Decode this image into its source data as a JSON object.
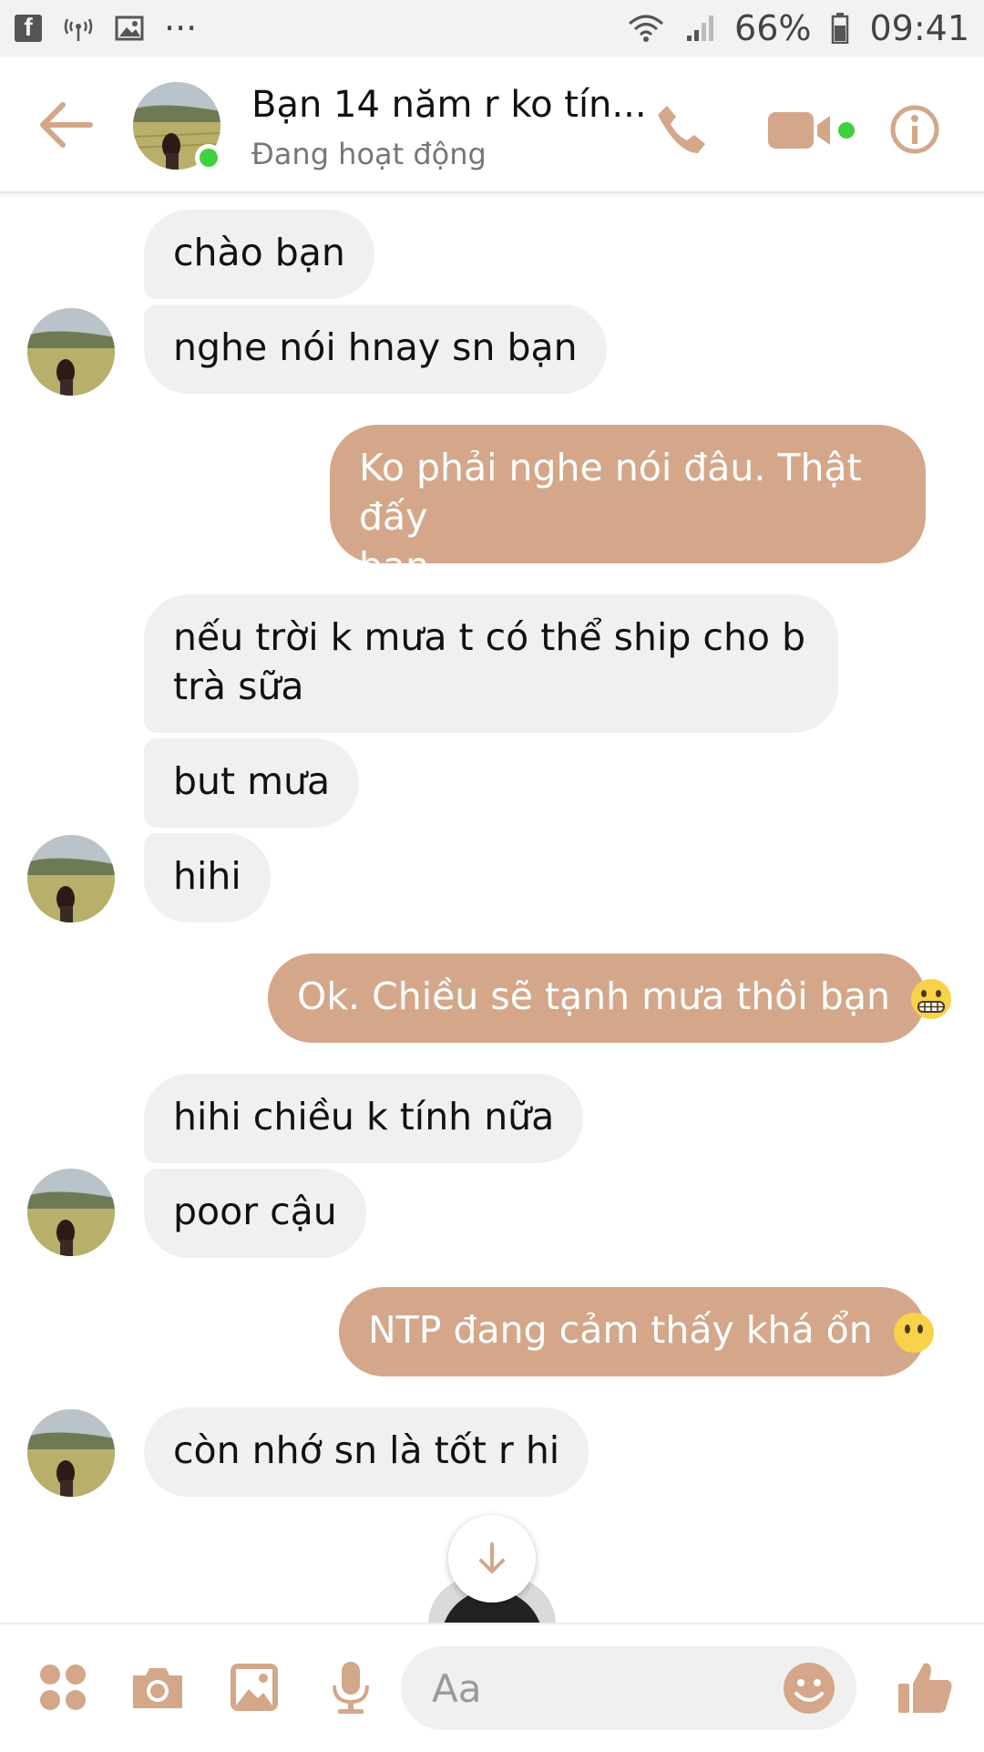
{
  "status_bar": {
    "icons": [
      "facebook-icon",
      "wifi-calling-icon",
      "gallery-icon",
      "more-dots-icon",
      "wifi-icon",
      "signal-icon",
      "battery-icon"
    ],
    "dots": "···",
    "battery_percent": "66%",
    "time": "09:41"
  },
  "header": {
    "title": "Bạn 14 năm r ko tín...",
    "status": "Đang hoạt động",
    "online": true,
    "icons": [
      "back-arrow-icon",
      "phone-icon",
      "video-camera-icon",
      "info-icon"
    ]
  },
  "messages": [
    {
      "side": "in",
      "text": "chào bạn"
    },
    {
      "side": "in",
      "text": "nghe nói hnay sn bạn"
    },
    {
      "side": "out",
      "lines": [
        "Ko phải nghe nói đâu. Thật đấy",
        "bạn"
      ]
    },
    {
      "side": "in",
      "lines": [
        "nếu trời k mưa t có thể ship cho b",
        "trà sữa"
      ]
    },
    {
      "side": "in",
      "text": "but mưa"
    },
    {
      "side": "in",
      "text": "hihi"
    },
    {
      "side": "out",
      "text": "Ok. Chiều sẽ tạnh mưa thôi bạn",
      "emoji": "grimacing-face-emoji"
    },
    {
      "side": "in",
      "text": "hihi chiều k tính nữa"
    },
    {
      "side": "in",
      "text": "poor cậu"
    },
    {
      "side": "out",
      "text": "NTP đang cảm thấy khá ổn",
      "emoji": "neutral-face-emoji"
    },
    {
      "side": "in",
      "text": "còn nhớ sn là tốt r hi"
    }
  ],
  "composer": {
    "placeholder": "Aa",
    "icons": [
      "apps-grid-icon",
      "camera-icon",
      "photo-icon",
      "microphone-icon",
      "emoji-icon",
      "thumbs-up-icon"
    ]
  },
  "colors": {
    "accent": "#d4a78a",
    "incoming_bubble": "#f0f0f0",
    "outgoing_bubble": "#d4a78a",
    "online_dot": "#3fd13f"
  }
}
